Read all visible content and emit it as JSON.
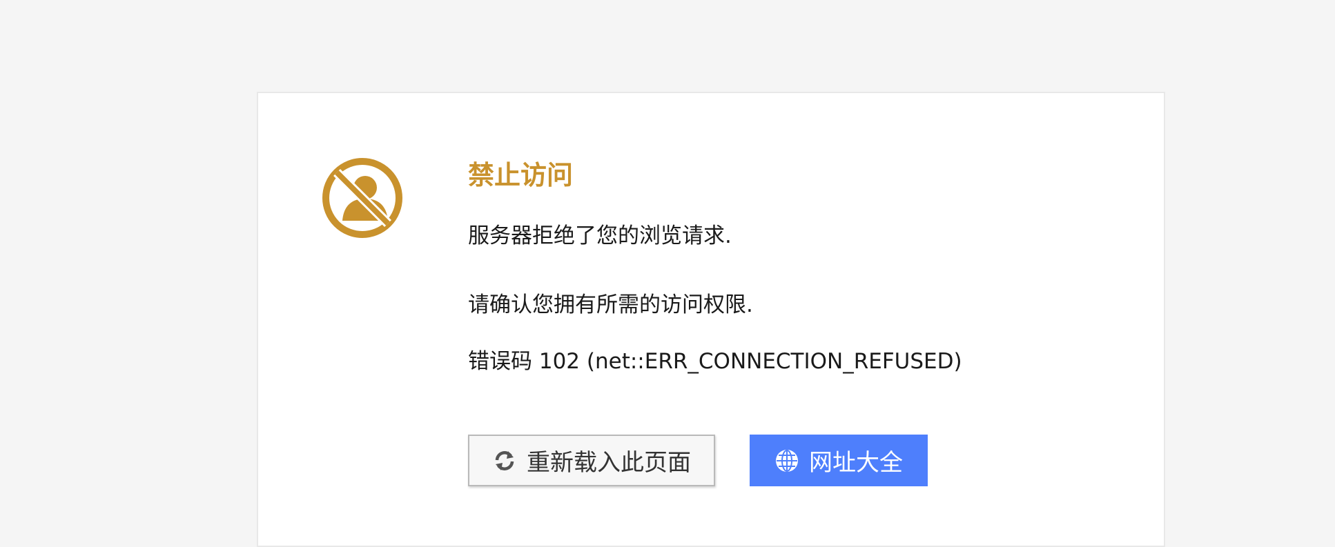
{
  "page": {
    "title": "禁止访问",
    "message_1": "服务器拒绝了您的浏览请求.",
    "message_2": "请确认您拥有所需的访问权限.",
    "error_code": "错误码 102 (net::ERR_CONNECTION_REFUSED)"
  },
  "buttons": {
    "reload_label": "重新载入此页面",
    "reload_icon": "refresh-icon",
    "nav_label": "网址大全",
    "nav_icon": "globe-icon"
  },
  "icons": {
    "main": "forbidden-user-icon"
  },
  "colors": {
    "accent": "#c9922d",
    "primary_button": "#4e7ffc",
    "background": "#f5f5f5",
    "card": "#ffffff"
  }
}
